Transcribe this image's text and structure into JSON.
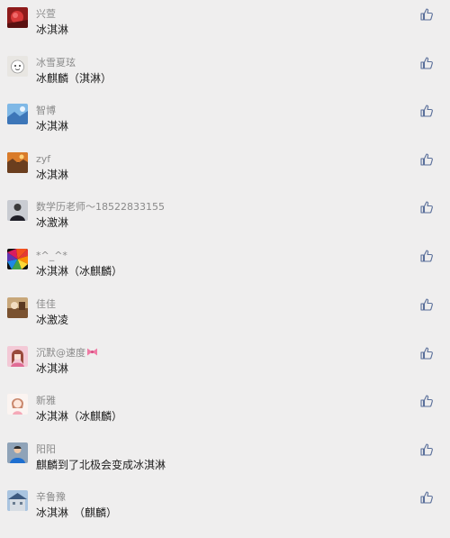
{
  "comments": [
    {
      "name": "兴萱",
      "text": "冰淇淋",
      "avatar": "red-flower-avatar",
      "like_icon": "thumbs-up-icon"
    },
    {
      "name": "冰雪夏玹",
      "text": "冰麒麟（淇淋）",
      "avatar": "cartoon-face-avatar",
      "like_icon": "thumbs-up-icon"
    },
    {
      "name": "智博",
      "text": "冰淇淋",
      "avatar": "blue-sky-avatar",
      "like_icon": "thumbs-up-icon"
    },
    {
      "name": "zyf",
      "text": "冰淇淋",
      "avatar": "orange-landscape-avatar",
      "like_icon": "thumbs-up-icon"
    },
    {
      "name": "数学历老师～18522833155",
      "text": "冰激淋",
      "avatar": "person-dark-avatar",
      "like_icon": "thumbs-up-icon"
    },
    {
      "name": "*^_^*",
      "text": "冰淇淋（冰麒麟）",
      "avatar": "rainbow-swirl-avatar",
      "like_icon": "thumbs-up-icon"
    },
    {
      "name": "佳佳",
      "text": "冰激凌",
      "avatar": "brown-photo-avatar",
      "like_icon": "thumbs-up-icon"
    },
    {
      "name": "沉默@速度",
      "text": "冰淇淋",
      "avatar": "girl-pink-avatar",
      "like_icon": "thumbs-up-icon",
      "name_icon": "pink-ribbon-icon"
    },
    {
      "name": "新雅",
      "text": "冰淇淋（冰麒麟）",
      "avatar": "cartoon-girl-avatar",
      "like_icon": "thumbs-up-icon"
    },
    {
      "name": "阳阳",
      "text": "麒麟到了北极会变成冰淇淋",
      "avatar": "boy-blue-avatar",
      "like_icon": "thumbs-up-icon"
    },
    {
      "name": "辛鲁豫",
      "text": "冰淇淋　（麒麟）",
      "avatar": "building-avatar",
      "like_icon": "thumbs-up-icon"
    }
  ],
  "colors": {
    "background": "#efeeee",
    "name": "#8a8a8a",
    "text": "#1f1f1f",
    "like": "#5a6f9a"
  }
}
